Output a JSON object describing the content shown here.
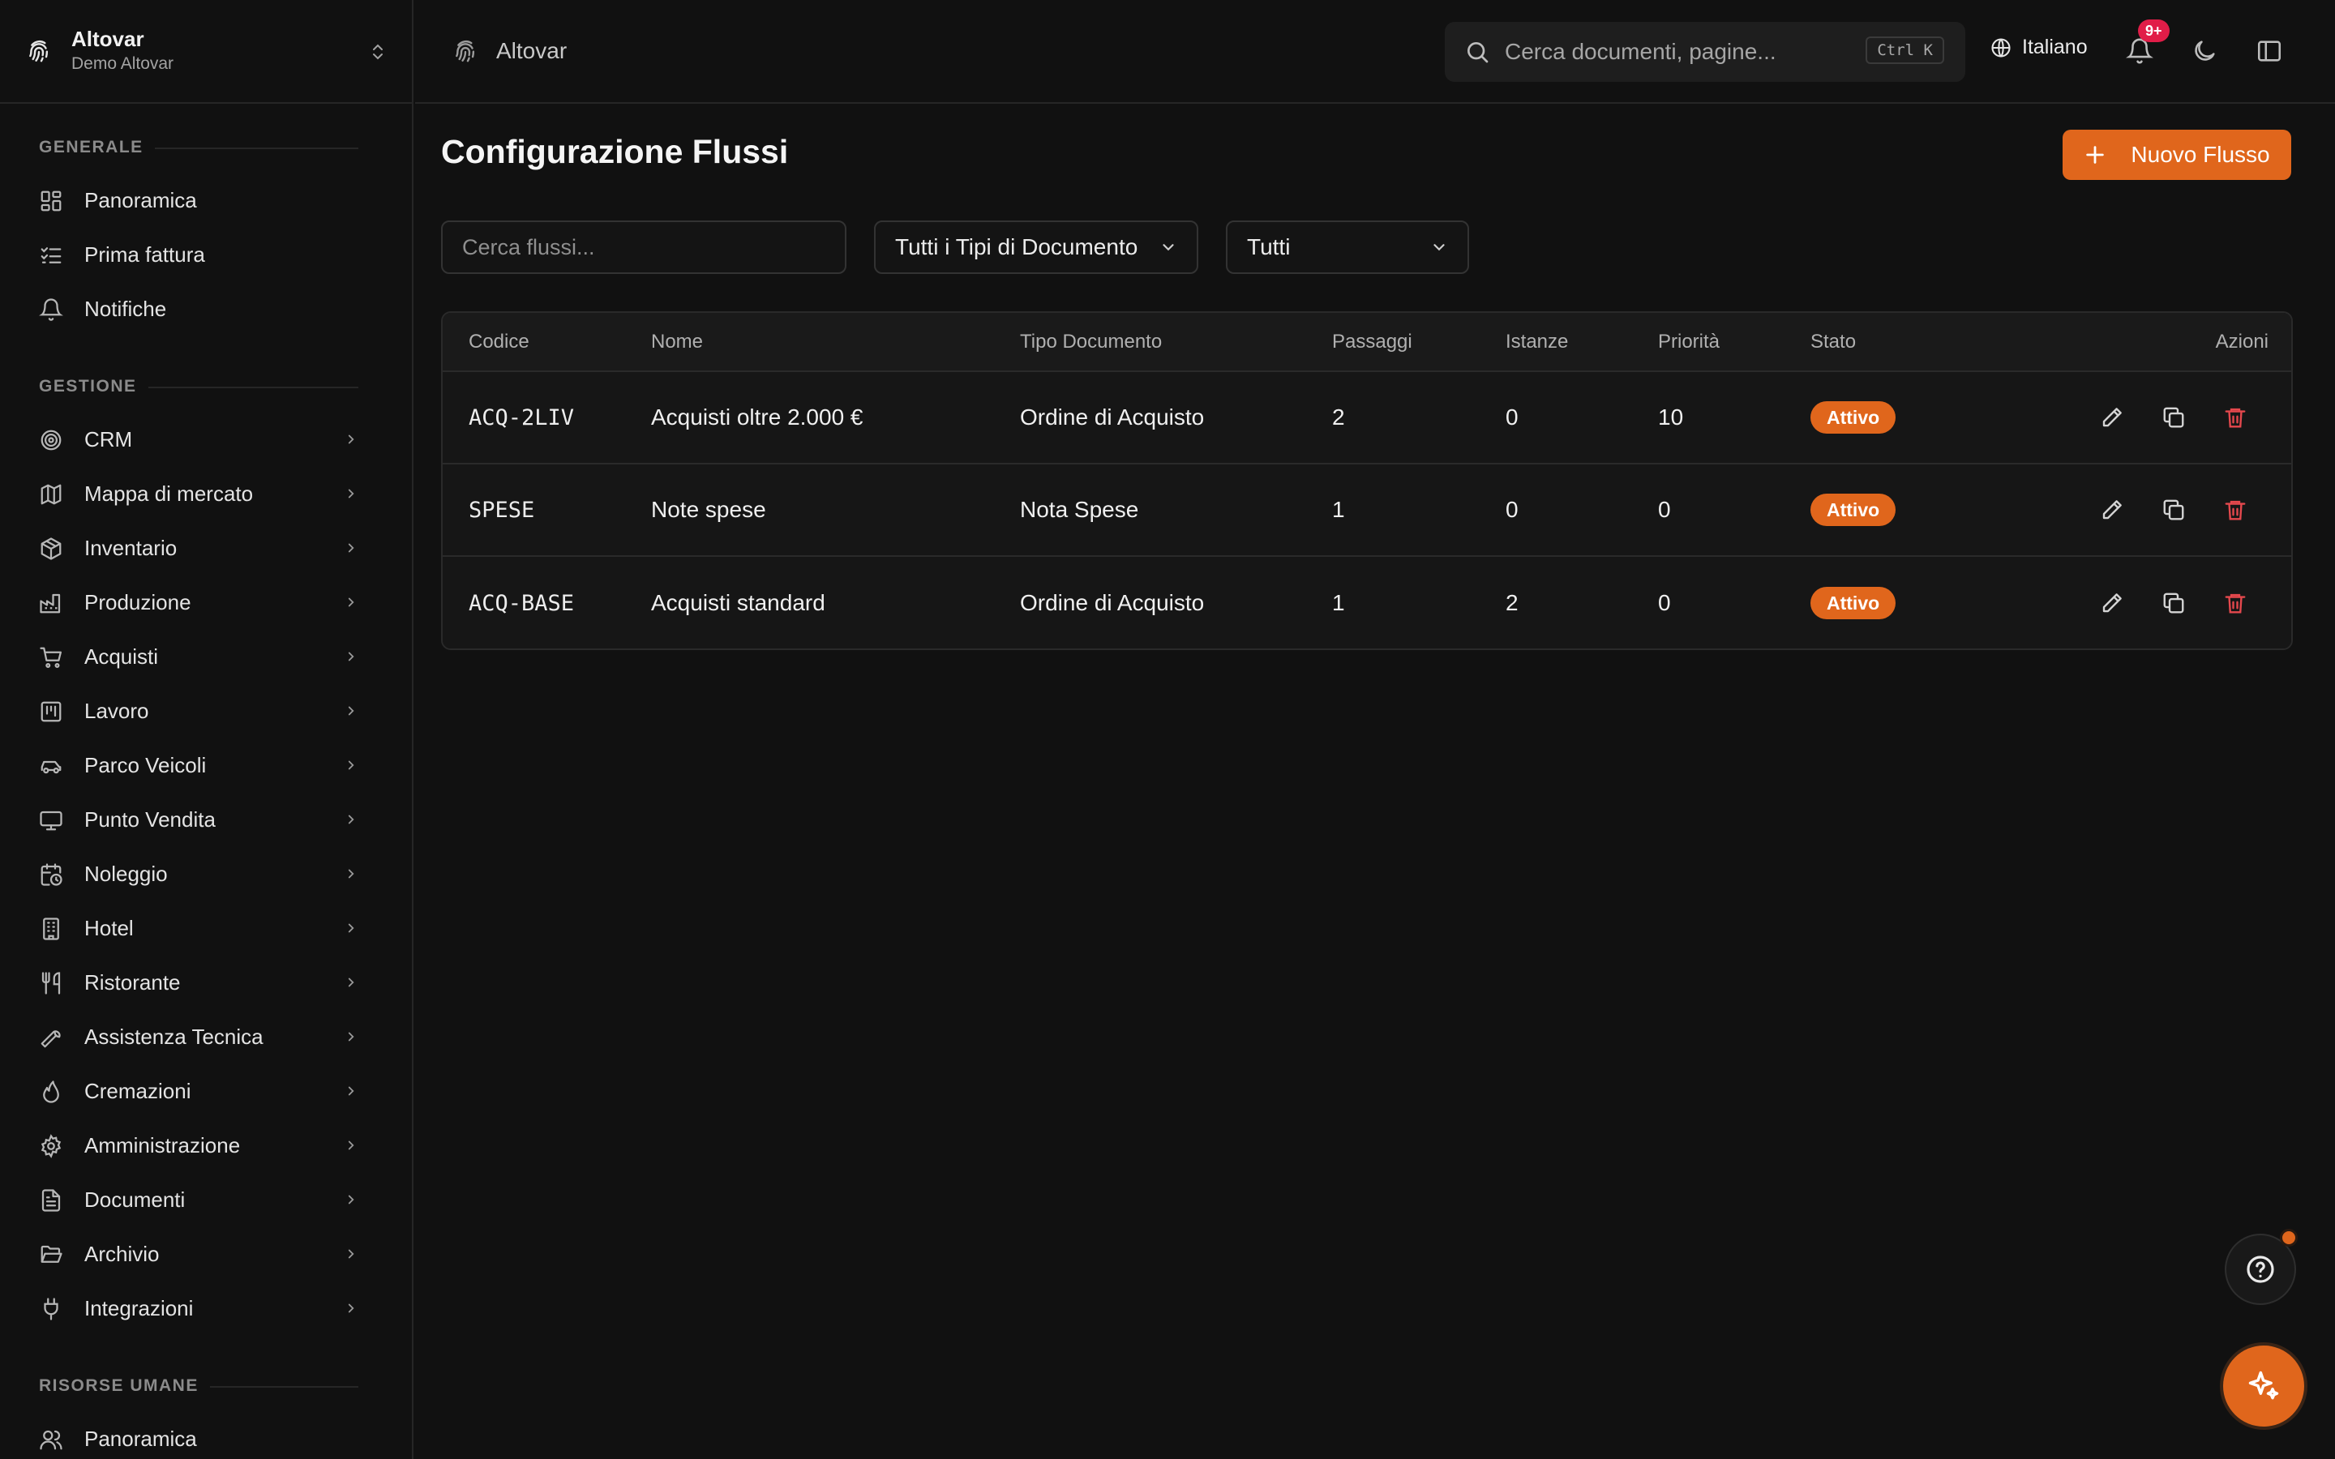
{
  "brand": {
    "name": "Altovar",
    "subtitle": "Demo Altovar"
  },
  "topbar": {
    "breadcrumb": "Altovar",
    "search_placeholder": "Cerca documenti, pagine...",
    "shortcut": "Ctrl K",
    "language": "Italiano",
    "notifications_badge": "9+"
  },
  "sidebar": {
    "sections": [
      {
        "title": "GENERALE",
        "items": [
          "Panoramica",
          "Prima fattura",
          "Notifiche"
        ]
      },
      {
        "title": "GESTIONE",
        "items": [
          "CRM",
          "Mappa di mercato",
          "Inventario",
          "Produzione",
          "Acquisti",
          "Lavoro",
          "Parco Veicoli",
          "Punto Vendita",
          "Noleggio",
          "Hotel",
          "Ristorante",
          "Assistenza Tecnica",
          "Cremazioni",
          "Amministrazione",
          "Documenti",
          "Archivio",
          "Integrazioni"
        ]
      },
      {
        "title": "RISORSE UMANE",
        "items": [
          "Panoramica"
        ]
      }
    ]
  },
  "main": {
    "title": "Configurazione Flussi",
    "new_button": "Nuovo Flusso",
    "filters": {
      "search_placeholder": "Cerca flussi...",
      "doc_type": "Tutti i Tipi di Documento",
      "status": "Tutti"
    },
    "table": {
      "headers": [
        "Codice",
        "Nome",
        "Tipo Documento",
        "Passaggi",
        "Istanze",
        "Priorità",
        "Stato",
        "Azioni"
      ],
      "rows": [
        [
          "ACQ-2LIV",
          "Acquisti oltre 2.000 €",
          "Ordine di Acquisto",
          "2",
          "0",
          "10",
          "Attivo"
        ],
        [
          "SPESE",
          "Note spese",
          "Nota Spese",
          "1",
          "0",
          "0",
          "Attivo"
        ],
        [
          "ACQ-BASE",
          "Acquisti standard",
          "Ordine di Acquisto",
          "1",
          "2",
          "0",
          "Attivo"
        ]
      ]
    }
  },
  "colors": {
    "accent": "#e0661c",
    "danger": "#e5484d",
    "background": "#111111"
  }
}
